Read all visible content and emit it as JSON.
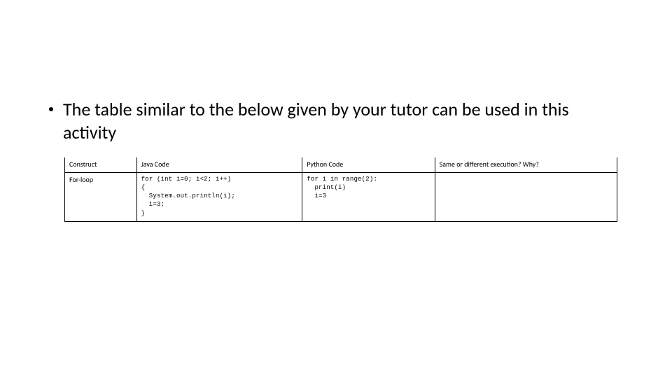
{
  "bullet": {
    "text": "The table similar to the below given by your tutor can be used in this activity"
  },
  "table": {
    "headers": {
      "construct": "Construct",
      "java": "Java Code",
      "python": "Python Code",
      "same": "Same or different execution? Why?"
    },
    "row": {
      "construct": "For-loop",
      "java_code": "for (int i=0; i<2; i++)\n{\n  System.out.println(i);\n  i=3;\n}",
      "python_code": "for i in range(2):\n  print(i)\n  i=3",
      "same": ""
    }
  }
}
